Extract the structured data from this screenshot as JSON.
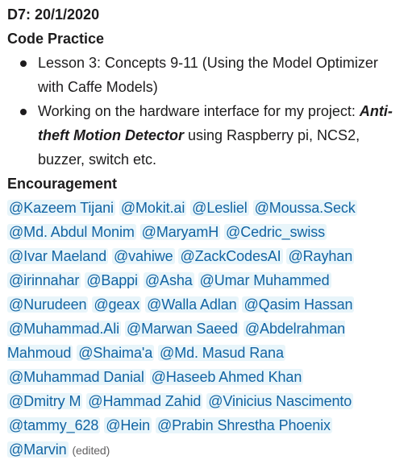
{
  "message": {
    "date_heading": "D7: 20/1/2020",
    "section_title": "Code Practice",
    "items": [
      {
        "text": "Lesson 3: Concepts 9-11 (Using the Model Optimizer with Caffe Models)"
      },
      {
        "prefix": "Working on the hardware interface for my project: ",
        "project": "Anti-theft Motion Detector",
        "suffix": " using Raspberry pi, NCS2, buzzer, switch etc."
      }
    ],
    "encouragement_title": "Encouragement",
    "mentions": [
      "@Kazeem Tijani",
      "@Mokit.ai",
      "@Lesliel",
      "@Moussa.Seck",
      "@Md. Abdul Monim",
      "@MaryamH",
      "@Cedric_swiss",
      "@Ivar Maeland",
      "@vahiwe",
      "@ZackCodesAI",
      "@Rayhan",
      "@irinnahar",
      "@Bappi",
      "@Asha",
      "@Umar Muhammed",
      "@Nurudeen",
      "@geax",
      "@Walla Adlan",
      "@Qasim Hassan",
      "@Muhammad.Ali",
      "@Marwan Saeed",
      "@Abdelrahman Mahmoud",
      "@Shaima'a",
      "@Md. Masud Rana",
      "@Muhammad Danial",
      "@Haseeb Ahmed Khan",
      "@Dmitry M",
      "@Hammad Zahid",
      "@Vinicius Nascimento",
      "@tammy_628",
      "@Hein",
      "@Prabin Shrestha Phoenix",
      "@Marvin"
    ],
    "edited_label": "(edited)"
  }
}
